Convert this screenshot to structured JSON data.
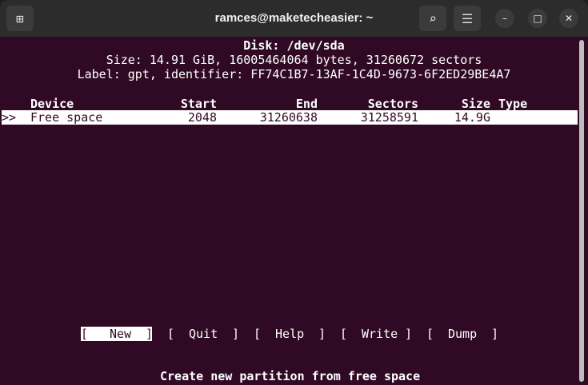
{
  "window": {
    "title": "ramces@maketecheasier: ~"
  },
  "disk": {
    "title": "Disk: /dev/sda",
    "size_line": "Size: 14.91 GiB, 16005464064 bytes, 31260672 sectors",
    "label_line": "Label: gpt, identifier: FF74C1B7-13AF-1C4D-9673-6F2ED29BE4A7"
  },
  "table": {
    "headers": {
      "device": "Device",
      "start": "Start",
      "end": "End",
      "sectors": "Sectors",
      "size": "Size",
      "type": "Type"
    },
    "rows": [
      {
        "marker": ">>",
        "device": "Free space",
        "start": "2048",
        "end": "31260638",
        "sectors": "31258591",
        "size": "14.9G",
        "type": ""
      }
    ]
  },
  "menu": {
    "buttons": [
      {
        "open": "[",
        "label": "New",
        "close": "]"
      },
      {
        "open": "[",
        "label": "Quit",
        "close": "]"
      },
      {
        "open": "[",
        "label": "Help",
        "close": "]"
      },
      {
        "open": "[",
        "label": "Write",
        "close": "]"
      },
      {
        "open": "[",
        "label": "Dump",
        "close": "]"
      }
    ]
  },
  "status": "Create new partition from free space"
}
